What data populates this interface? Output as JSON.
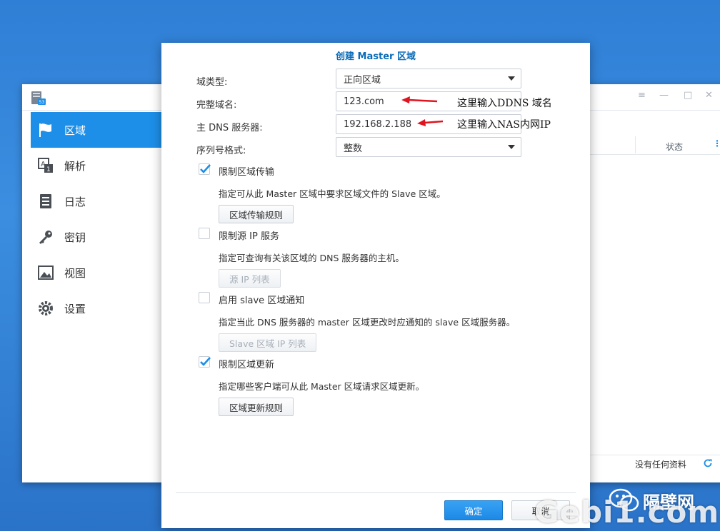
{
  "sidebar": {
    "items": [
      {
        "label": "区域",
        "icon": "flag-icon",
        "active": true
      },
      {
        "label": "解析",
        "icon": "resolve-icon",
        "active": false
      },
      {
        "label": "日志",
        "icon": "log-icon",
        "active": false
      },
      {
        "label": "密钥",
        "icon": "key-icon",
        "active": false
      },
      {
        "label": "视图",
        "icon": "view-icon",
        "active": false
      },
      {
        "label": "设置",
        "icon": "gear-icon",
        "active": false
      }
    ]
  },
  "grid": {
    "status_header": "状态",
    "no_data": "没有任何资料"
  },
  "window_controls": {
    "pin": "≡",
    "minimize": "—",
    "maximize": "□",
    "close": "✕"
  },
  "dialog": {
    "title": "创建 Master 区域",
    "zone_type_label": "域类型:",
    "zone_type_value": "正向区域",
    "domain_name_label": "完整域名:",
    "domain_name_value": "123.com",
    "master_dns_label": "主 DNS 服务器:",
    "master_dns_value": "192.168.2.188",
    "serial_format_label": "序列号格式:",
    "serial_format_value": "整数",
    "options": [
      {
        "label": "限制区域传输",
        "checked": true,
        "desc": "指定可从此 Master 区域中要求区域文件的 Slave 区域。",
        "button": "区域传输规则",
        "button_enabled": true
      },
      {
        "label": "限制源 IP 服务",
        "checked": false,
        "desc": "指定可查询有关该区域的 DNS 服务器的主机。",
        "button": "源 IP 列表",
        "button_enabled": false
      },
      {
        "label": "启用 slave 区域通知",
        "checked": false,
        "desc": "指定当此 DNS 服务器的 master 区域更改时应通知的 slave 区域服务器。",
        "button": "Slave 区域 IP 列表",
        "button_enabled": false
      },
      {
        "label": "限制区域更新",
        "checked": true,
        "desc": "指定哪些客户端可从此 Master 区域请求区域更新。",
        "button": "区域更新规则",
        "button_enabled": true
      }
    ],
    "ok_label": "确定",
    "cancel_label": "取消"
  },
  "annotations": {
    "ddns_note": "这里输入DDNS 域名",
    "nas_ip_note": "这里输入NAS内网IP",
    "arrow_color": "#e0141e"
  },
  "watermark": {
    "site": "Gebi1.com",
    "brand": "隔壁网"
  },
  "colors": {
    "accent": "#1d8fe8",
    "title": "#0a6bb8"
  }
}
